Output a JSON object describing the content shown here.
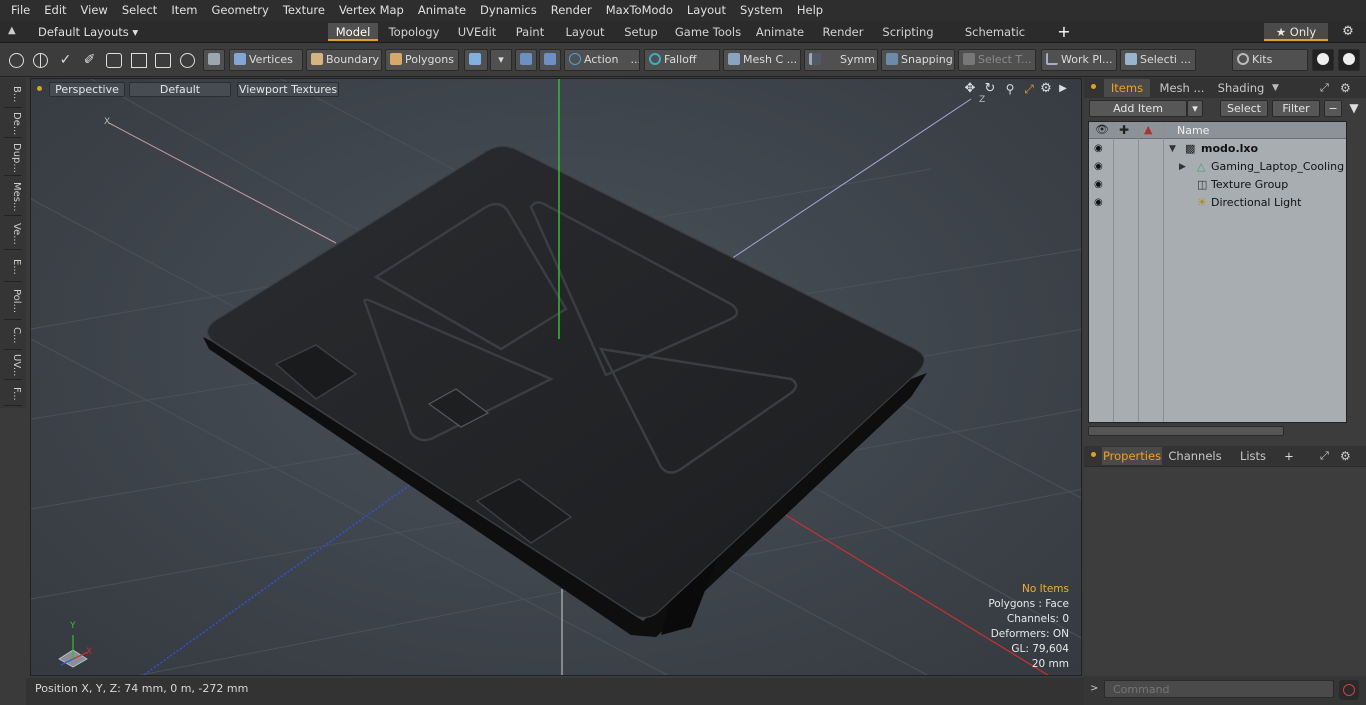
{
  "menu": [
    "File",
    "Edit",
    "View",
    "Select",
    "Item",
    "Geometry",
    "Texture",
    "Vertex Map",
    "Animate",
    "Dynamics",
    "Render",
    "MaxToModo",
    "Layout",
    "System",
    "Help"
  ],
  "layout_selector": "Default Layouts ▾",
  "layout_tabs": [
    "Model",
    "Topology",
    "UVEdit",
    "Paint",
    "Layout",
    "Setup",
    "Game Tools",
    "Animate",
    "Render",
    "Scripting",
    "Schematic Fusion"
  ],
  "only_label": "★ Only",
  "toolbar": {
    "vertices": "Vertices",
    "boundary": "Boundary",
    "polygons": "Polygons",
    "action": "Action",
    "falloff": "Falloff",
    "mesh": "Mesh C ...",
    "symm": "Symm ...",
    "snapping": "Snapping",
    "select_t": "Select T...",
    "work_pl": "Work Pl...",
    "selecti": "Selecti ...",
    "kits": "Kits"
  },
  "left_tabs": [
    "B...",
    "De...",
    "Dup...",
    "Mes...",
    "Ve...",
    "E...",
    "Pol...",
    "C...",
    "UV...",
    "F..."
  ],
  "viewport": {
    "perspective": "Perspective",
    "default": "Default",
    "viewport_textures": "Viewport Textures",
    "info": {
      "no_items": "No Items",
      "polygons": "Polygons : Face",
      "channels": "Channels: 0",
      "deformers": "Deformers: ON",
      "gl": "GL: 79,604",
      "scale": "20 mm"
    },
    "axis": {
      "y": "Y",
      "x": "X",
      "z": "Z"
    }
  },
  "status": {
    "position": "Position X, Y, Z:   74 mm, 0 m, -272 mm"
  },
  "items_panel": {
    "tabs": [
      "Items",
      "Mesh ...",
      "Shading"
    ],
    "add_item": "Add Item",
    "select": "Select",
    "filter": "Filter",
    "name_header": "Name",
    "rows": [
      "modo.lxo",
      "Gaming_Laptop_Cooling ...",
      "Texture Group",
      "Directional Light"
    ]
  },
  "properties_panel": {
    "tabs": [
      "Properties",
      "Channels",
      "Lists"
    ],
    "add": "+"
  },
  "command": {
    "placeholder": "Command"
  },
  "colors": {
    "accent": "#f0a020",
    "x_axis": "#c83030",
    "y_axis": "#30c030",
    "z_axis": "#3050e0"
  }
}
